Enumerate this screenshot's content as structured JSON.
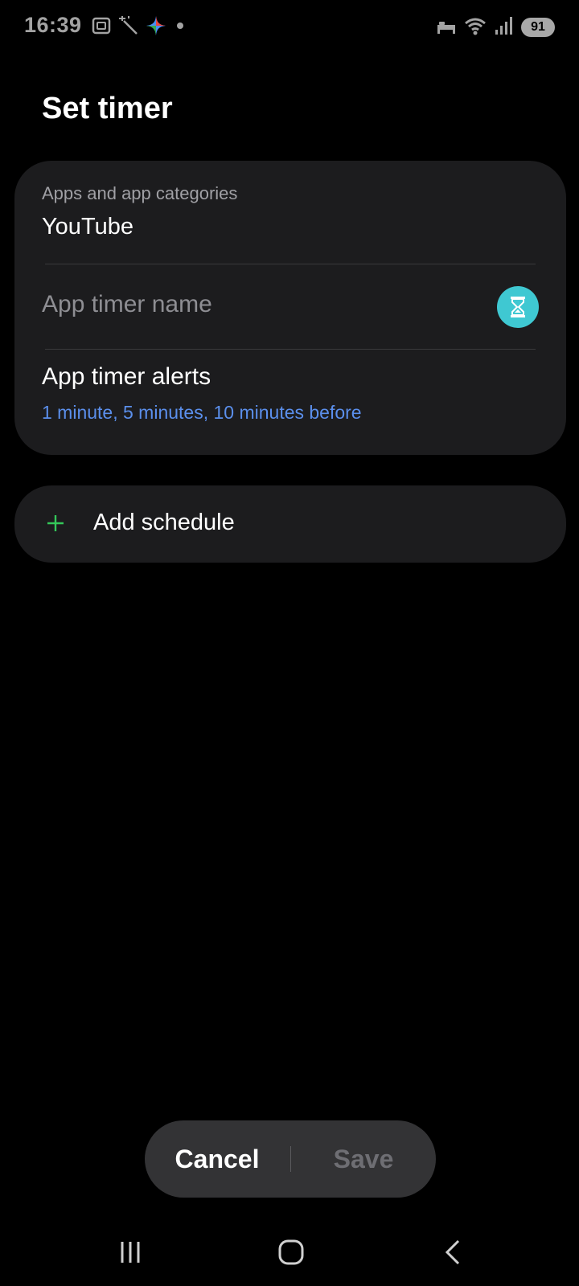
{
  "status_bar": {
    "time": "16:39",
    "battery": "91",
    "left_icons": [
      "screenshot-icon",
      "magic-wand-icon",
      "gemini-spark-icon",
      "dot-icon"
    ],
    "right_icons": [
      "bed-icon",
      "wifi-icon",
      "signal-icon",
      "battery-icon"
    ]
  },
  "page": {
    "title": "Set timer"
  },
  "apps": {
    "label": "Apps and app categories",
    "value": "YouTube"
  },
  "timer_name": {
    "placeholder": "App timer name",
    "value": "",
    "icon": "hourglass-icon",
    "icon_color": "#3fc8d2"
  },
  "alerts": {
    "title": "App timer alerts",
    "summary": "1 minute, 5 minutes, 10 minutes before",
    "summary_color": "#5b8fec"
  },
  "schedule": {
    "label": "Add schedule",
    "icon": "plus-icon",
    "icon_color": "#34c759"
  },
  "actions": {
    "cancel": "Cancel",
    "save": "Save"
  },
  "nav": {
    "recent": "recent-apps-icon",
    "home": "home-icon",
    "back": "back-icon"
  }
}
